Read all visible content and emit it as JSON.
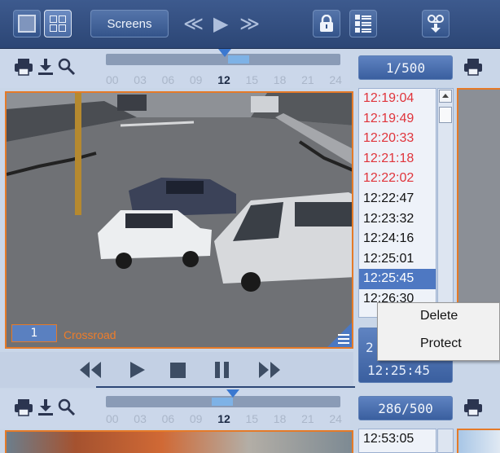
{
  "toolbar": {
    "screens_label": "Screens",
    "arrows": {
      "prev": "≪",
      "play": "▶",
      "next": "≫"
    }
  },
  "timeline_top": {
    "ticks": [
      "00",
      "03",
      "06",
      "09",
      "12",
      "15",
      "18",
      "21",
      "24"
    ],
    "current_tick": "12",
    "counter": "1/500"
  },
  "camera": {
    "number": "1",
    "name": "Crossroad"
  },
  "time_list": {
    "items": [
      {
        "time": "12:19:04",
        "protected": true
      },
      {
        "time": "12:19:49",
        "protected": true
      },
      {
        "time": "12:20:33",
        "protected": true
      },
      {
        "time": "12:21:18",
        "protected": true
      },
      {
        "time": "12:22:02",
        "protected": true
      },
      {
        "time": "12:22:47",
        "protected": false
      },
      {
        "time": "12:23:32",
        "protected": false
      },
      {
        "time": "12:24:16",
        "protected": false
      },
      {
        "time": "12:25:01",
        "protected": false
      },
      {
        "time": "12:25:45",
        "protected": false,
        "selected": true
      },
      {
        "time": "12:26:30",
        "protected": false
      }
    ]
  },
  "time_box": {
    "line1": "2",
    "line2": "12:25:45"
  },
  "context_menu": {
    "delete": "Delete",
    "protect": "Protect"
  },
  "timeline_bottom": {
    "ticks": [
      "00",
      "03",
      "06",
      "09",
      "12",
      "15",
      "18",
      "21",
      "24"
    ],
    "current_tick": "12",
    "counter": "286/500"
  },
  "bottom_list": {
    "first_time": "12:53:05"
  },
  "colors": {
    "accent_orange": "#e57a28",
    "protected_red": "#e0343b",
    "toolbar_blue": "#2c4675",
    "selection_blue": "#4e78c2"
  }
}
